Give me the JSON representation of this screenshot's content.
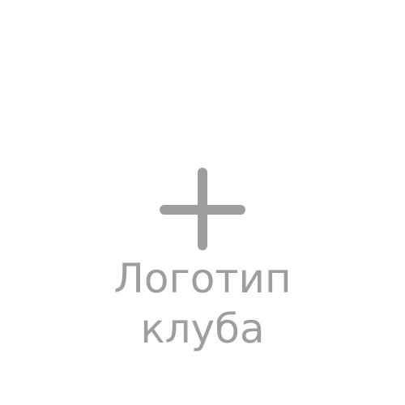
{
  "upload": {
    "icon": "plus-icon",
    "label_line1": "Логотип",
    "label_line2": "клуба",
    "icon_color": "#9e9e9e",
    "text_color": "#9e9e9e",
    "background": "#ffffff"
  }
}
